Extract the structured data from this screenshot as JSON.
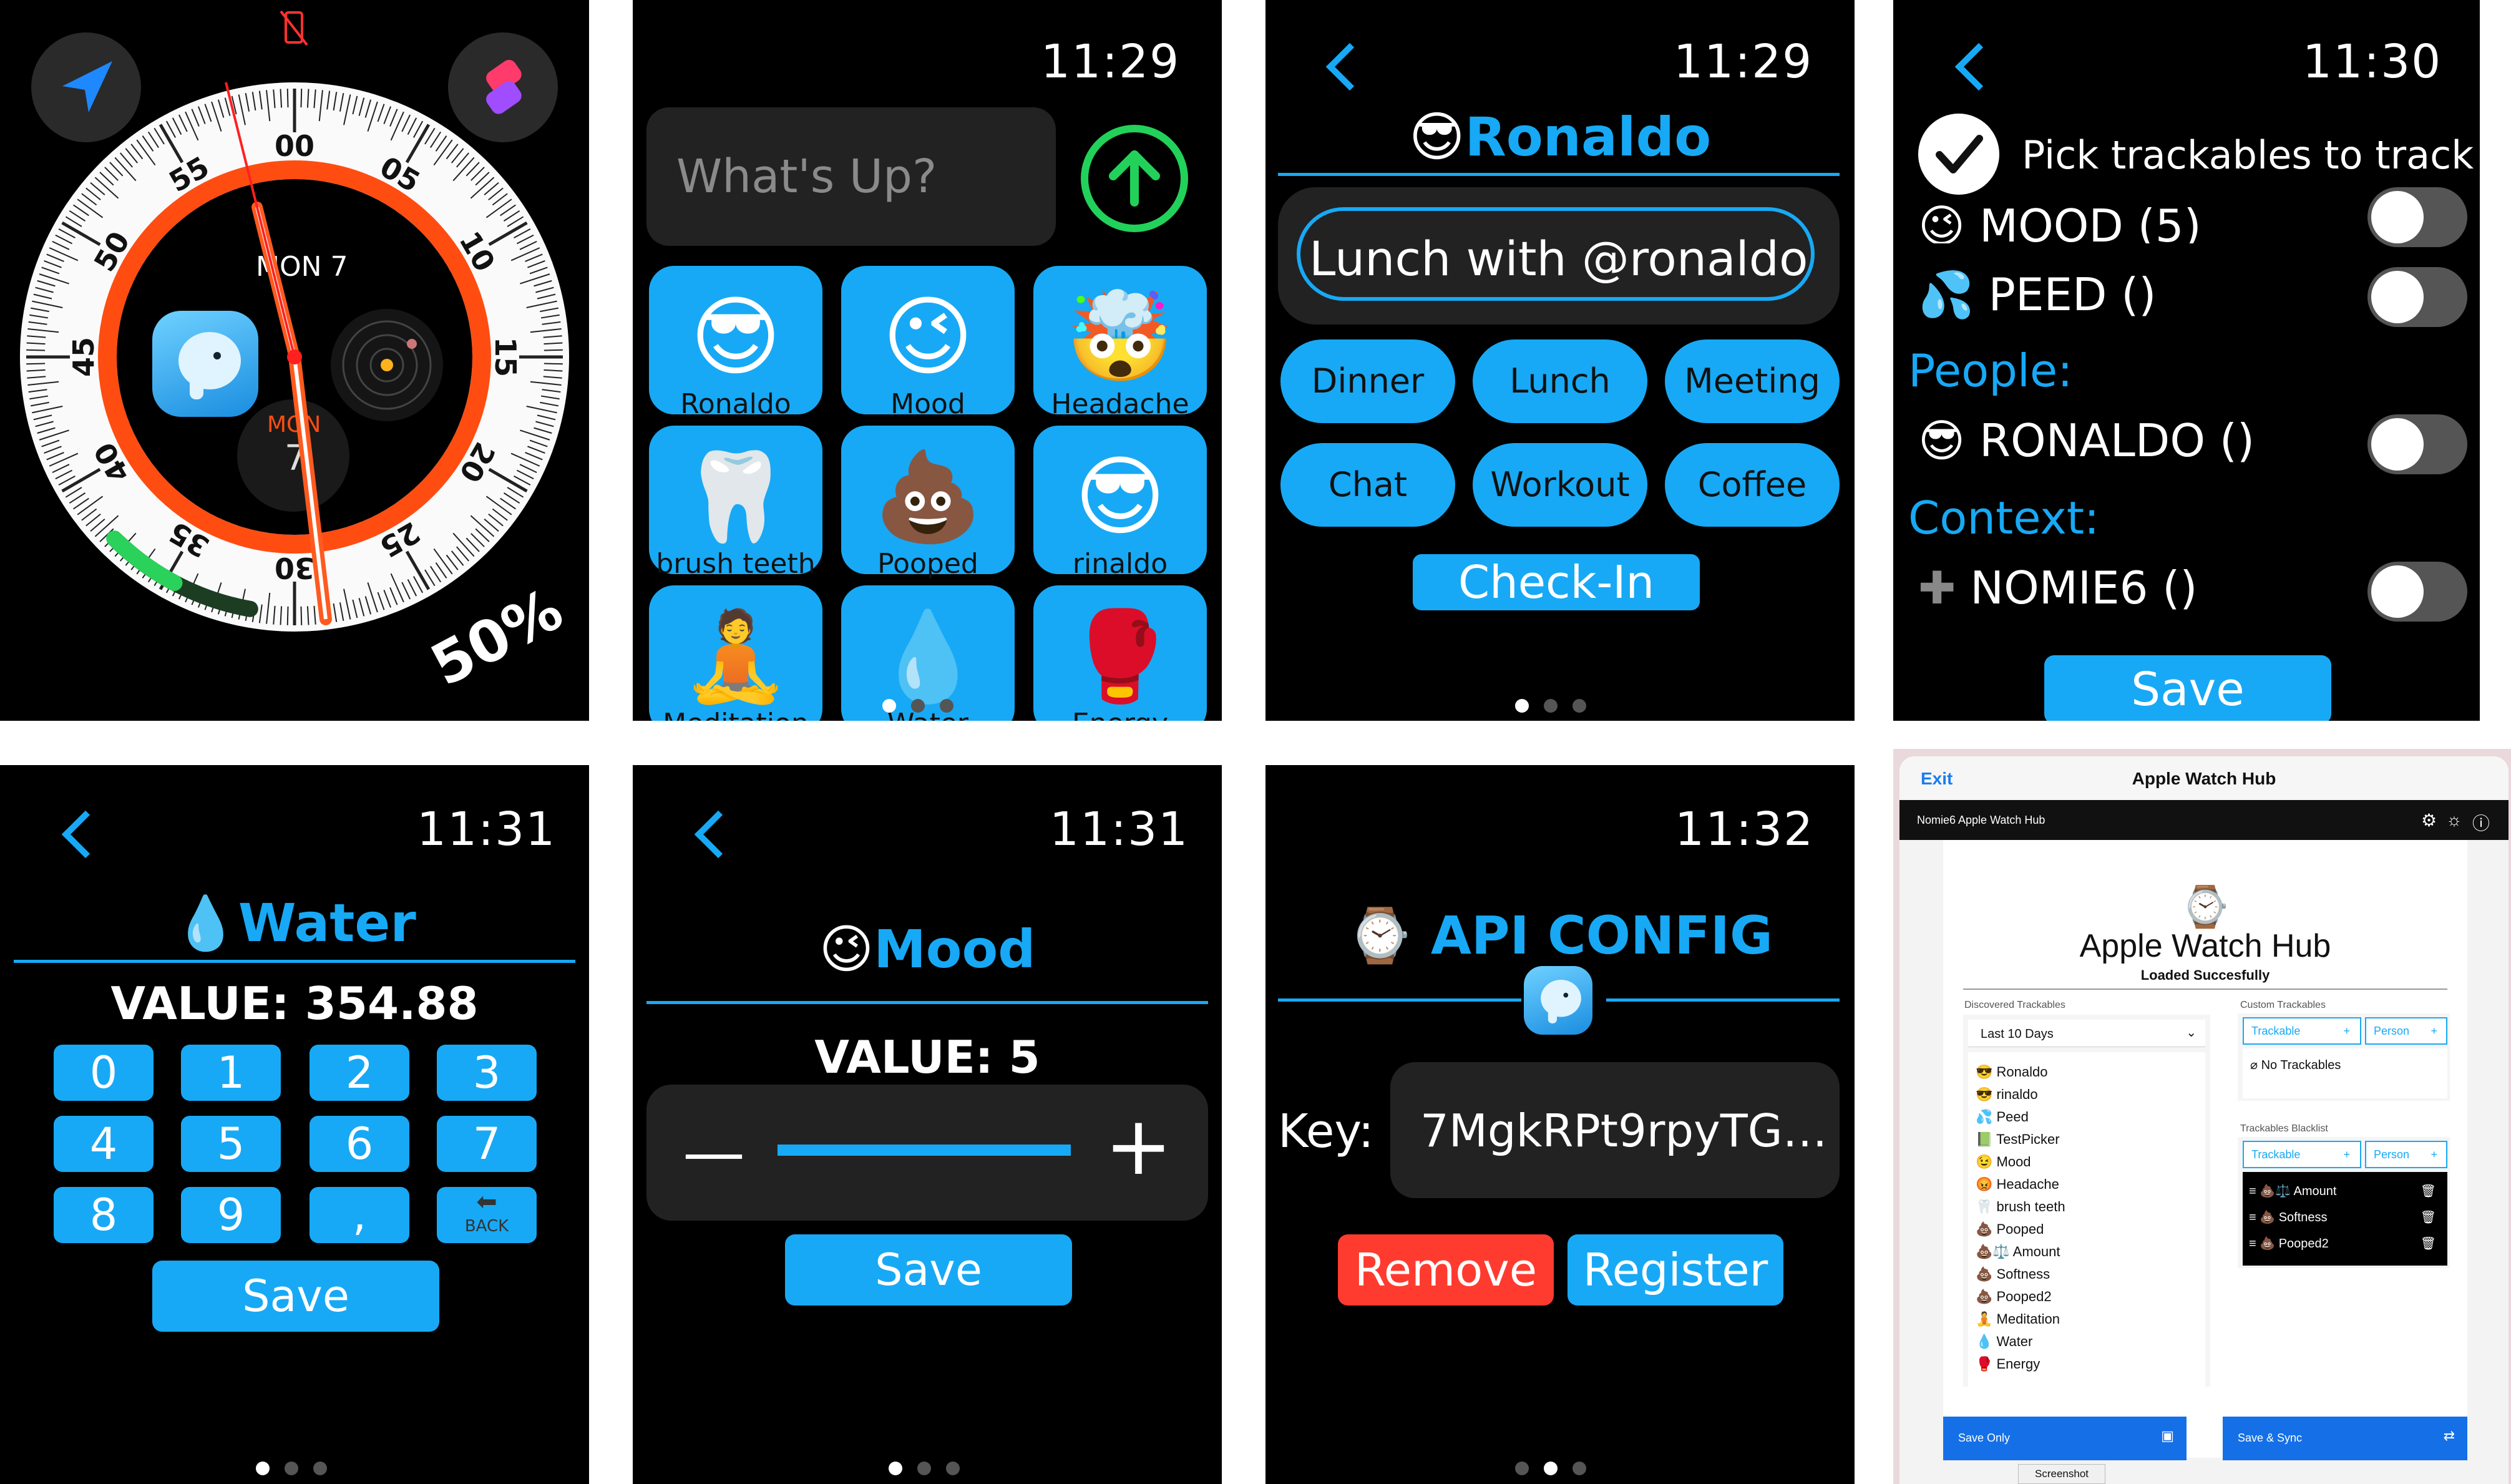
{
  "panel1": {
    "minutes": [
      "00",
      "05",
      "10",
      "15",
      "20",
      "25",
      "30",
      "35",
      "40",
      "45",
      "50",
      "55"
    ],
    "date": "MON 7",
    "sub_month": "MON",
    "sub_day": "7",
    "battery_pct": 0.5,
    "battery": "50%",
    "accent": "#ff5a1f"
  },
  "panel2": {
    "time": "11:29",
    "input_placeholder": "What's Up?",
    "tiles": [
      {
        "emoji": "😎",
        "label": "Ronaldo"
      },
      {
        "emoji": "😉",
        "label": "Mood"
      },
      {
        "emoji": "🤯",
        "label": "Headache"
      },
      {
        "emoji": "🦷",
        "label": "brush teeth"
      },
      {
        "emoji": "💩",
        "label": "Pooped"
      },
      {
        "emoji": "😎",
        "label": "rinaldo"
      },
      {
        "emoji": "🧘",
        "label": "Meditation"
      },
      {
        "emoji": "💧",
        "label": "Water"
      },
      {
        "emoji": "🥊",
        "label": "Energy"
      }
    ]
  },
  "panel3": {
    "time": "11:29",
    "title_emoji": "😎",
    "title": "Ronaldo",
    "note": "Lunch with @ronaldo",
    "tags": [
      "Dinner",
      "Lunch",
      "Meeting",
      "Chat",
      "Workout",
      "Coffee"
    ],
    "checkin": "Check-In"
  },
  "panel4": {
    "time": "11:30",
    "header": "Pick trackables to track",
    "row_partial": "MOOD (5)",
    "peed": "PEED ()",
    "peed_icon": "💦",
    "people_heading": "People:",
    "ronaldo": "RONALDO ()",
    "ronaldo_icon": "😎",
    "context_heading": "Context:",
    "nomie": "NOMIE6 ()",
    "save": "Save"
  },
  "panel5": {
    "time": "11:31",
    "title_emoji": "💧",
    "title": "Water",
    "value": "VALUE: 354.88",
    "keys": [
      "0",
      "1",
      "2",
      "3",
      "4",
      "5",
      "6",
      "7",
      "8",
      "9",
      ","
    ],
    "back": "BACK",
    "save": "Save"
  },
  "panel6": {
    "time": "11:31",
    "title_emoji": "😉",
    "title": "Mood",
    "value": "VALUE: 5",
    "minus": "—",
    "plus": "+",
    "level": 1.0,
    "save": "Save"
  },
  "panel7": {
    "time": "11:32",
    "title_emoji": "⌚",
    "title": "API CONFIG",
    "key_label": "Key:",
    "key_value": "7MgkRPt9rpyTG…",
    "remove": "Remove",
    "register": "Register"
  },
  "panel8": {
    "exit": "Exit",
    "title": "Apple Watch Hub",
    "subbar": "Nomie6 Apple Watch Hub",
    "icon": "⌚",
    "heading": "Apple Watch Hub",
    "status": "Loaded Succesfully",
    "discovered_label": "Discovered Trackables",
    "range": "Last 10 Days",
    "discovered": [
      "😎 Ronaldo",
      "😎 rinaldo",
      "💦 Peed",
      "📗 TestPicker",
      "😉 Mood",
      "😡 Headache",
      "🦷 brush teeth",
      "💩 Pooped",
      "💩⚖️ Amount",
      "💩 Softness",
      "💩 Pooped2",
      "🧘 Meditation",
      "💧 Water",
      "🥊 Energy"
    ],
    "custom_label": "Custom Trackables",
    "trackable_btn": "Trackable",
    "person_btn": "Person",
    "no_trackables": "⌀ No Trackables",
    "blacklist_label": "Trackables Blacklist",
    "blacklist": [
      "💩⚖️ Amount",
      "💩 Softness",
      "💩 Pooped2"
    ],
    "save_only": "Save Only",
    "save_sync": "Save & Sync",
    "screenshot_tag": "Screenshot"
  }
}
